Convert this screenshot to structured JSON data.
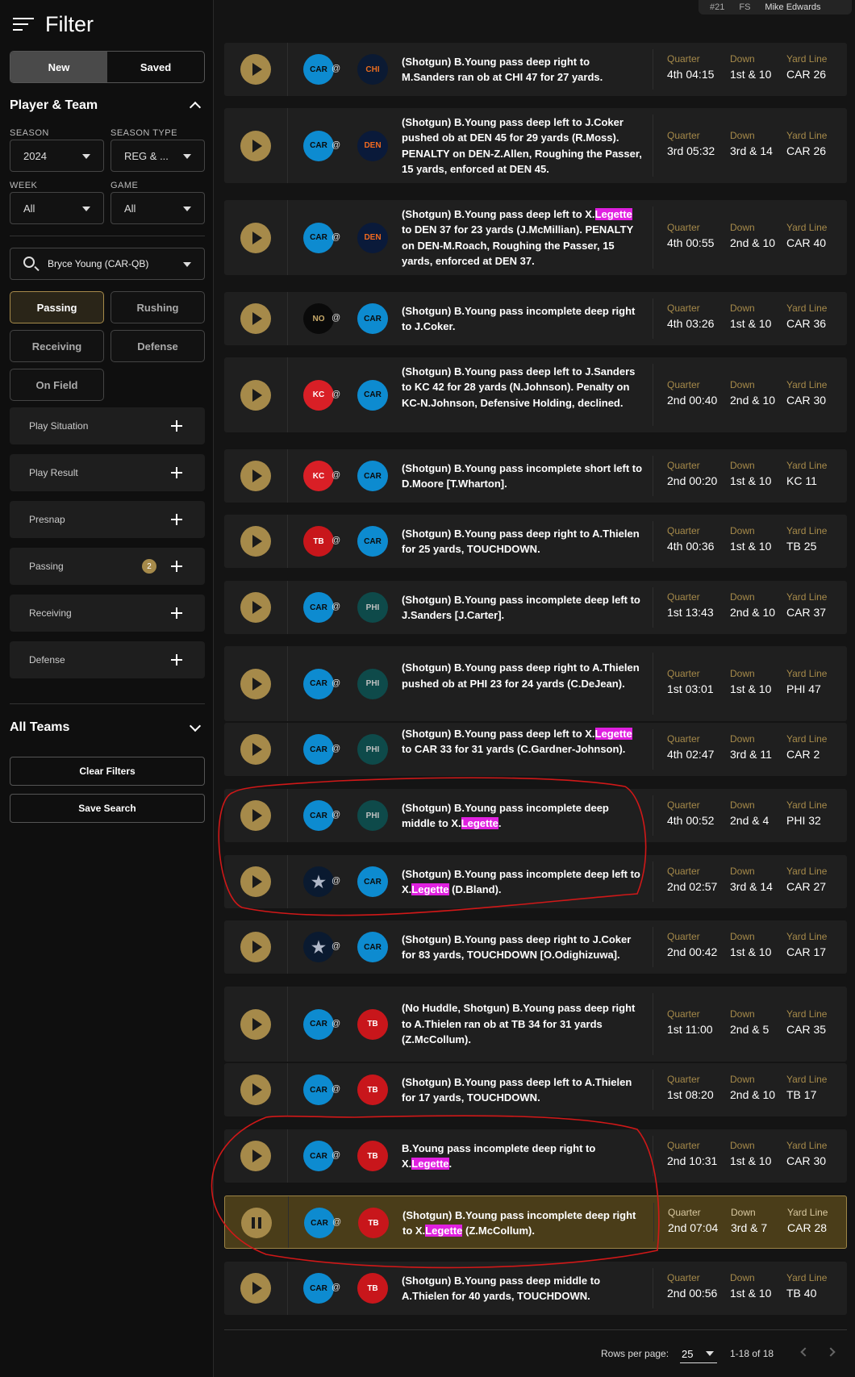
{
  "sidebar": {
    "title": "Filter",
    "tabs": {
      "new": "New",
      "saved": "Saved"
    },
    "player_team": {
      "title": "Player & Team",
      "season_label": "SEASON",
      "season_value": "2024",
      "season_type_label": "SEASON TYPE",
      "season_type_value": "REG & ...",
      "week_label": "WEEK",
      "week_value": "All",
      "game_label": "GAME",
      "game_value": "All",
      "player_value": "Bryce Young (CAR-QB)"
    },
    "play_types": [
      "Passing",
      "Rushing",
      "Receiving",
      "Defense",
      "On Field"
    ],
    "accordions": [
      {
        "label": "Play Situation"
      },
      {
        "label": "Play Result"
      },
      {
        "label": "Presnap"
      },
      {
        "label": "Passing",
        "badge": "2"
      },
      {
        "label": "Receiving"
      },
      {
        "label": "Defense"
      }
    ],
    "all_teams": "All Teams",
    "clear_filters": "Clear Filters",
    "save_search": "Save Search"
  },
  "top_info": {
    "number": "#21",
    "pos": "FS",
    "name": "Mike Edwards"
  },
  "labels": {
    "quarter": "Quarter",
    "down": "Down",
    "yard": "Yard Line"
  },
  "plays": [
    {
      "away": "CAR",
      "home": "CHI",
      "desc": "(Shotgun) B.Young pass deep right to M.Sanders ran ob at CHI 47 for 27 yards.",
      "quarter": "4th 04:15",
      "down": "1st & 10",
      "yard": "CAR 26"
    },
    {
      "away": "CAR",
      "home": "DEN",
      "desc": "(Shotgun) B.Young pass deep left to J.Coker pushed ob at DEN 45 for 29 yards (R.Moss). PENALTY on DEN-Z.Allen, Roughing the Passer, 15 yards, enforced at DEN 45.",
      "quarter": "3rd 05:32",
      "down": "3rd & 14",
      "yard": "CAR 26"
    },
    {
      "away": "CAR",
      "home": "DEN",
      "desc": "(Shotgun) B.Young pass deep left to X.Legette to DEN 37 for 23 yards (J.McMillian). PENALTY on DEN-M.Roach, Roughing the Passer, 15 yards, enforced at DEN 37.",
      "quarter": "4th 00:55",
      "down": "2nd & 10",
      "yard": "CAR 40"
    },
    {
      "away": "NO",
      "home": "CAR",
      "desc": "(Shotgun) B.Young pass incomplete deep right to J.Coker.",
      "quarter": "4th 03:26",
      "down": "1st & 10",
      "yard": "CAR 36"
    },
    {
      "away": "KC",
      "home": "CAR",
      "desc": "(Shotgun) B.Young pass deep left to J.Sanders to KC 42 for 28 yards (N.Johnson). Penalty on KC-N.Johnson, Defensive Holding, declined.",
      "quarter": "2nd 00:40",
      "down": "2nd & 10",
      "yard": "CAR 30"
    },
    {
      "away": "KC",
      "home": "CAR",
      "desc": "(Shotgun) B.Young pass incomplete short left to D.Moore [T.Wharton].",
      "quarter": "2nd 00:20",
      "down": "1st & 10",
      "yard": "KC 11"
    },
    {
      "away": "TB",
      "home": "CAR",
      "desc": "(Shotgun) B.Young pass deep right to A.Thielen for 25 yards, TOUCHDOWN.",
      "quarter": "4th 00:36",
      "down": "1st & 10",
      "yard": "TB 25"
    },
    {
      "away": "CAR",
      "home": "PHI",
      "desc": "(Shotgun) B.Young pass incomplete deep left to J.Sanders [J.Carter].",
      "quarter": "1st 13:43",
      "down": "2nd & 10",
      "yard": "CAR 37"
    },
    {
      "away": "CAR",
      "home": "PHI",
      "desc": "(Shotgun) B.Young pass deep right to A.Thielen pushed ob at PHI 23 for 24 yards (C.DeJean).",
      "quarter": "1st 03:01",
      "down": "1st & 10",
      "yard": "PHI 47"
    },
    {
      "away": "CAR",
      "home": "PHI",
      "desc": "(Shotgun) B.Young pass deep left to X.Legette to CAR 33 for 31 yards (C.Gardner-Johnson).",
      "quarter": "4th 02:47",
      "down": "3rd & 11",
      "yard": "CAR 2"
    },
    {
      "away": "CAR",
      "home": "PHI",
      "desc": "(Shotgun) B.Young pass incomplete deep middle to X.Legette.",
      "quarter": "4th 00:52",
      "down": "2nd & 4",
      "yard": "PHI 32"
    },
    {
      "away": "DAL",
      "home": "CAR",
      "desc": "(Shotgun) B.Young pass incomplete deep left to X.Legette (D.Bland).",
      "quarter": "2nd 02:57",
      "down": "3rd & 14",
      "yard": "CAR 27"
    },
    {
      "away": "DAL",
      "home": "CAR",
      "desc": "(Shotgun) B.Young pass deep right to J.Coker for 83 yards, TOUCHDOWN [O.Odighizuwa].",
      "quarter": "2nd 00:42",
      "down": "1st & 10",
      "yard": "CAR 17"
    },
    {
      "away": "CAR",
      "home": "TB",
      "desc": "(No Huddle, Shotgun) B.Young pass deep right to A.Thielen ran ob at TB 34 for 31 yards (Z.McCollum).",
      "quarter": "1st 11:00",
      "down": "2nd & 5",
      "yard": "CAR 35"
    },
    {
      "away": "CAR",
      "home": "TB",
      "desc": "(Shotgun) B.Young pass deep left to A.Thielen for 17 yards, TOUCHDOWN.",
      "quarter": "1st 08:20",
      "down": "2nd & 10",
      "yard": "TB 17"
    },
    {
      "away": "CAR",
      "home": "TB",
      "desc": "B.Young pass incomplete deep right to X.Legette.",
      "quarter": "2nd 10:31",
      "down": "1st & 10",
      "yard": "CAR 30"
    },
    {
      "away": "CAR",
      "home": "TB",
      "desc": "(Shotgun) B.Young pass incomplete deep right to X.Legette (Z.McCollum).",
      "quarter": "2nd 07:04",
      "down": "3rd & 7",
      "yard": "CAR 28",
      "active": true
    },
    {
      "away": "CAR",
      "home": "TB",
      "desc": "(Shotgun) B.Young pass deep middle to A.Thielen for 40 yards, TOUCHDOWN.",
      "quarter": "2nd 00:56",
      "down": "1st & 10",
      "yard": "TB 40"
    }
  ],
  "pagination": {
    "rows_label": "Rows per page:",
    "rows_value": "25",
    "range": "1-18 of 18"
  },
  "highlight_term": "Legette",
  "team_abbr": {
    "CAR": "CAR",
    "CHI": "CHI",
    "DEN": "DEN",
    "NO": "NO",
    "KC": "KC",
    "TB": "TB",
    "PHI": "PHI",
    "DAL": "★"
  }
}
